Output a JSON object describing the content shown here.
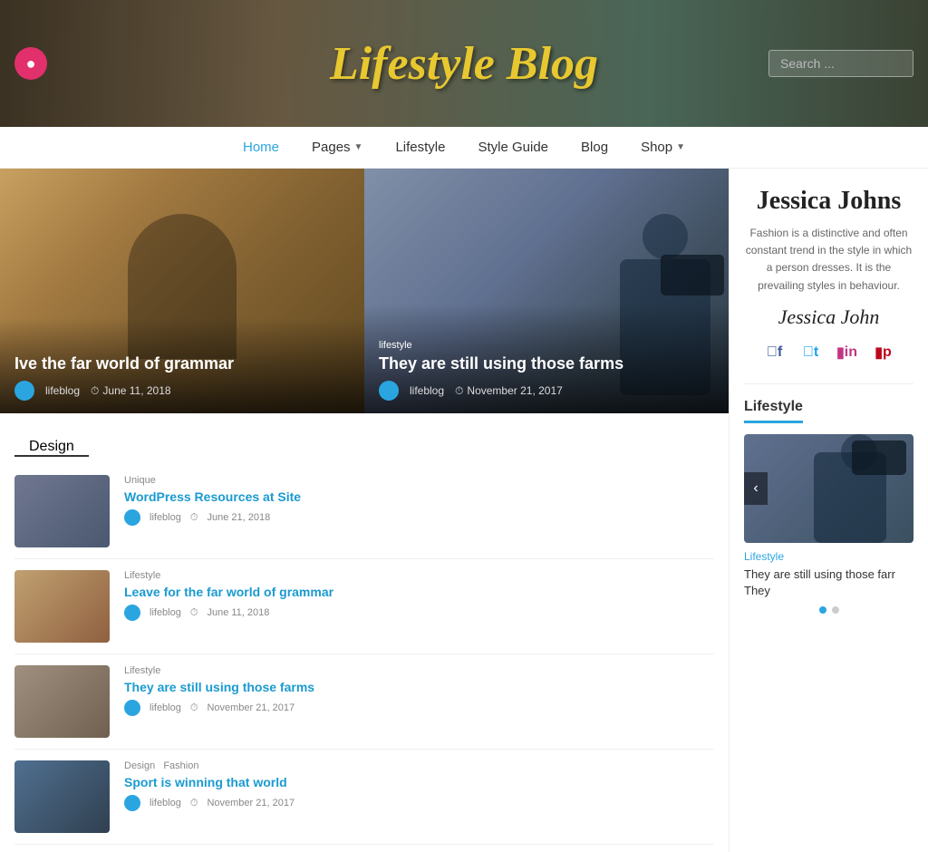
{
  "header": {
    "title": "Lifestyle Blog",
    "search_placeholder": "Search ...",
    "instagram_icon": "📷"
  },
  "nav": {
    "items": [
      {
        "label": "Home",
        "active": true,
        "has_arrow": false
      },
      {
        "label": "Pages",
        "active": false,
        "has_arrow": true
      },
      {
        "label": "Lifestyle",
        "active": false,
        "has_arrow": false
      },
      {
        "label": "Style Guide",
        "active": false,
        "has_arrow": false
      },
      {
        "label": "Blog",
        "active": false,
        "has_arrow": false
      },
      {
        "label": "Shop",
        "active": false,
        "has_arrow": true
      }
    ]
  },
  "featured": {
    "left": {
      "title": "Ive the far world of grammar",
      "author": "lifeblog",
      "date": "June 11, 2018"
    },
    "right": {
      "category": "lifestyle",
      "title": "They are still using those farms",
      "author": "lifeblog",
      "date": "November 21, 2017"
    }
  },
  "section_label": "Design",
  "cards": [
    {
      "category": "Unique",
      "title": "WordPress Resources at Site",
      "author": "lifeblog",
      "date": "June 21, 2018",
      "thumb": "1"
    },
    {
      "category": "Lifestyle",
      "title": "Leave for the far world of grammar",
      "author": "lifeblog",
      "date": "June 11, 2018",
      "thumb": "2"
    },
    {
      "category": "Lifestyle",
      "title": "They are still using those farms",
      "author": "lifeblog",
      "date": "November 21, 2017",
      "thumb": "3"
    },
    {
      "category_tags": [
        "Design",
        "Fashion"
      ],
      "title": "Sport is winning that world",
      "author": "lifeblog",
      "date": "November 21, 2017",
      "thumb": "4"
    }
  ],
  "sidebar": {
    "author_name": "Jessica Johns",
    "author_bio": "Fashion is a distinctive and often constant trend in the style in which a person dresses. It is the prevailing styles in behaviour.",
    "author_signature": "Jessica John",
    "social": {
      "facebook": "f",
      "twitter": "t",
      "instagram": "in",
      "pinterest": "p"
    },
    "lifestyle_section_label": "Lifestyle",
    "sidebar_post_category": "Lifestyle",
    "sidebar_post_title": "They are still using those farr They",
    "dots": [
      true,
      false
    ]
  }
}
